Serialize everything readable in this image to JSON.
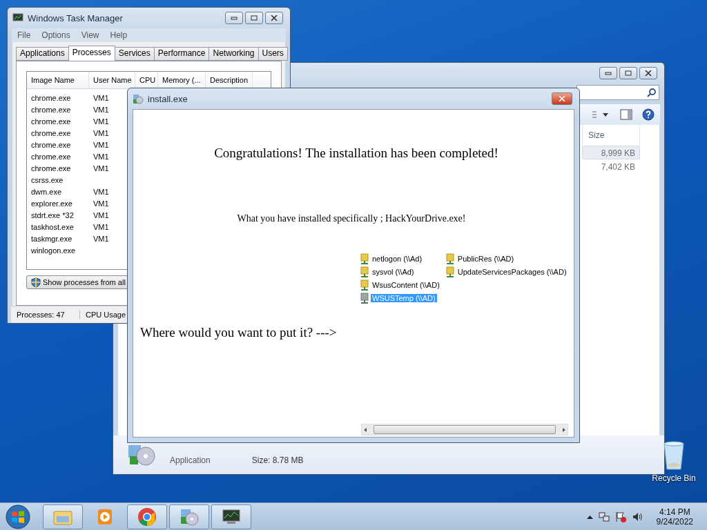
{
  "desktop_icons": [
    {
      "label": "Recycle Bin"
    }
  ],
  "explorer": {
    "size_header": "Size",
    "rows": [
      {
        "size": "8,999 KB",
        "selected": true
      },
      {
        "size": "7,402 KB",
        "selected": false
      }
    ],
    "details": {
      "type": "Application",
      "size": "Size: 8.78 MB"
    }
  },
  "task_manager": {
    "title": "Windows Task Manager",
    "menu": [
      "File",
      "Options",
      "View",
      "Help"
    ],
    "tabs": [
      {
        "label": "Applications",
        "selected": false
      },
      {
        "label": "Processes",
        "selected": true
      },
      {
        "label": "Services",
        "selected": false
      },
      {
        "label": "Performance",
        "selected": false
      },
      {
        "label": "Networking",
        "selected": false
      },
      {
        "label": "Users",
        "selected": false
      }
    ],
    "columns": [
      "Image Name",
      "User Name",
      "CPU",
      "Memory (...",
      "Description"
    ],
    "rows": [
      {
        "image_name": "chrome.exe",
        "user_name": "VM1"
      },
      {
        "image_name": "chrome.exe",
        "user_name": "VM1"
      },
      {
        "image_name": "chrome.exe",
        "user_name": "VM1"
      },
      {
        "image_name": "chrome.exe",
        "user_name": "VM1"
      },
      {
        "image_name": "chrome.exe",
        "user_name": "VM1"
      },
      {
        "image_name": "chrome.exe",
        "user_name": "VM1"
      },
      {
        "image_name": "chrome.exe",
        "user_name": "VM1"
      },
      {
        "image_name": "csrss.exe",
        "user_name": ""
      },
      {
        "image_name": "dwm.exe",
        "user_name": "VM1"
      },
      {
        "image_name": "explorer.exe",
        "user_name": "VM1"
      },
      {
        "image_name": "stdrt.exe *32",
        "user_name": "VM1"
      },
      {
        "image_name": "taskhost.exe",
        "user_name": "VM1"
      },
      {
        "image_name": "taskmgr.exe",
        "user_name": "VM1"
      },
      {
        "image_name": "winlogon.exe",
        "user_name": ""
      }
    ],
    "button": "Show processes from all",
    "status": [
      "Processes: 47",
      "CPU Usage"
    ]
  },
  "dialog": {
    "title": "install.exe",
    "heading": "Congratulations! The installation has been completed!",
    "subtitle": "What you have installed specifically ; HackYourDrive.exe!",
    "shares": [
      {
        "label": "netlogon (\\\\Ad)",
        "selected": false
      },
      {
        "label": "sysvol (\\\\Ad)",
        "selected": false
      },
      {
        "label": "WsusContent (\\\\AD)",
        "selected": false
      },
      {
        "label": "WSUSTemp (\\\\AD)",
        "selected": true
      },
      {
        "label": "PublicRes (\\\\AD)",
        "selected": false
      },
      {
        "label": "UpdateServicesPackages (\\\\AD)",
        "selected": false
      }
    ],
    "prompt": "Where would you want to put it? --->"
  },
  "taskbar": {
    "apps": [
      {
        "kind": "explorer",
        "running": true
      },
      {
        "kind": "media",
        "running": false
      },
      {
        "kind": "chrome",
        "running": true
      },
      {
        "kind": "installer",
        "running": true
      },
      {
        "kind": "taskmgr",
        "running": true
      }
    ],
    "time": "4:14 PM",
    "date": "9/24/2022"
  }
}
